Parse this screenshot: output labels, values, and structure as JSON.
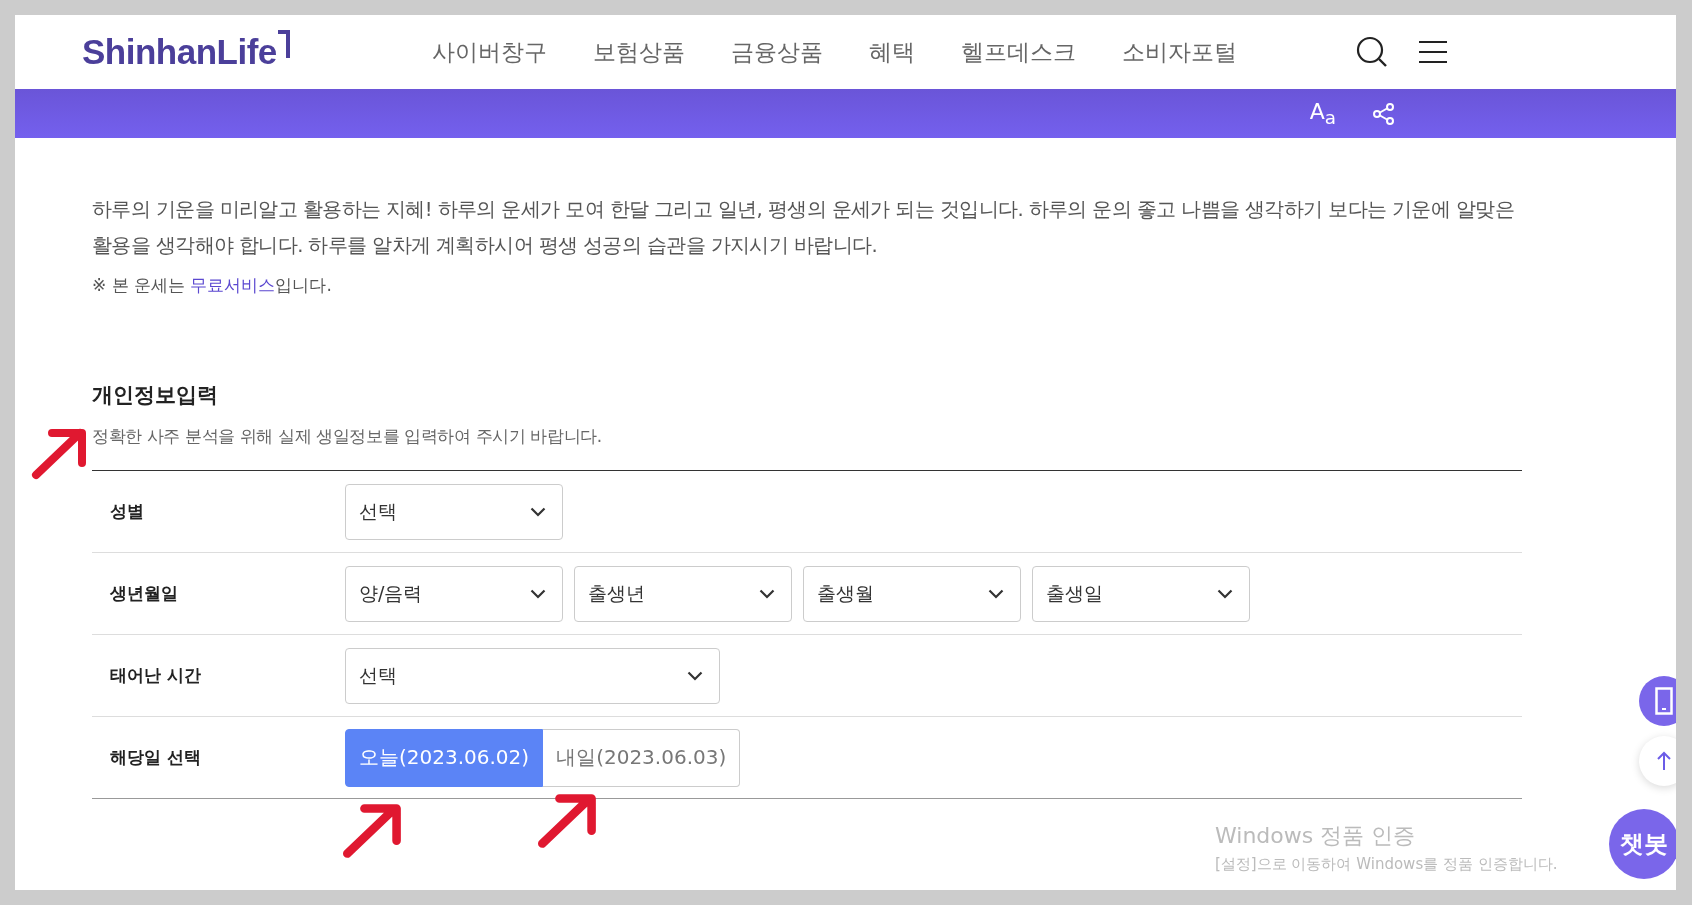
{
  "header": {
    "logo": "ShinhanLife",
    "nav": [
      "사이버창구",
      "보험상품",
      "금융상품",
      "혜택",
      "헬프데스크",
      "소비자포털"
    ]
  },
  "toolbar": {
    "font_size_button": "A$_{a}$"
  },
  "intro": {
    "paragraph": "하루의 기운을 미리알고 활용하는 지혜! 하루의 운세가 모여 한달 그리고 일년, 평생의 운세가 되는 것입니다. 하루의 운의 좋고 나쁨을 생각하기 보다는 기운에 알맞은 활용을 생각해야 합니다. 하루를 알차게 계획하시어 평생 성공의 습관을 가지시기 바랍니다.",
    "note_prefix": "※ 본 운세는 ",
    "note_link": "무료서비스",
    "note_suffix": "입니다."
  },
  "form": {
    "title": "개인정보입력",
    "subtitle": "정확한 사주 분석을 위해 실제 생일정보를 입력하여 주시기 바랍니다.",
    "rows": [
      {
        "label": "성별",
        "kind": "selects",
        "selects": [
          {
            "value": "선택",
            "wide": false
          }
        ]
      },
      {
        "label": "생년월일",
        "kind": "selects",
        "selects": [
          {
            "value": "양/음력",
            "wide": false
          },
          {
            "value": "출생년",
            "wide": false
          },
          {
            "value": "출생월",
            "wide": false
          },
          {
            "value": "출생일",
            "wide": false
          }
        ]
      },
      {
        "label": "태어난 시간",
        "kind": "selects",
        "selects": [
          {
            "value": "선택",
            "wide": true
          }
        ]
      },
      {
        "label": "해당일 선택",
        "kind": "dates",
        "options": [
          {
            "label": "오늘(2023.06.02)",
            "selected": true
          },
          {
            "label": "내일(2023.06.03)",
            "selected": false
          }
        ]
      }
    ]
  },
  "floating": {
    "chatbot": "챗봇"
  },
  "os_notice": {
    "title": "Windows 정품 인증",
    "message": "[설정]으로 이동하여 Windows를 정품 인증합니다."
  }
}
